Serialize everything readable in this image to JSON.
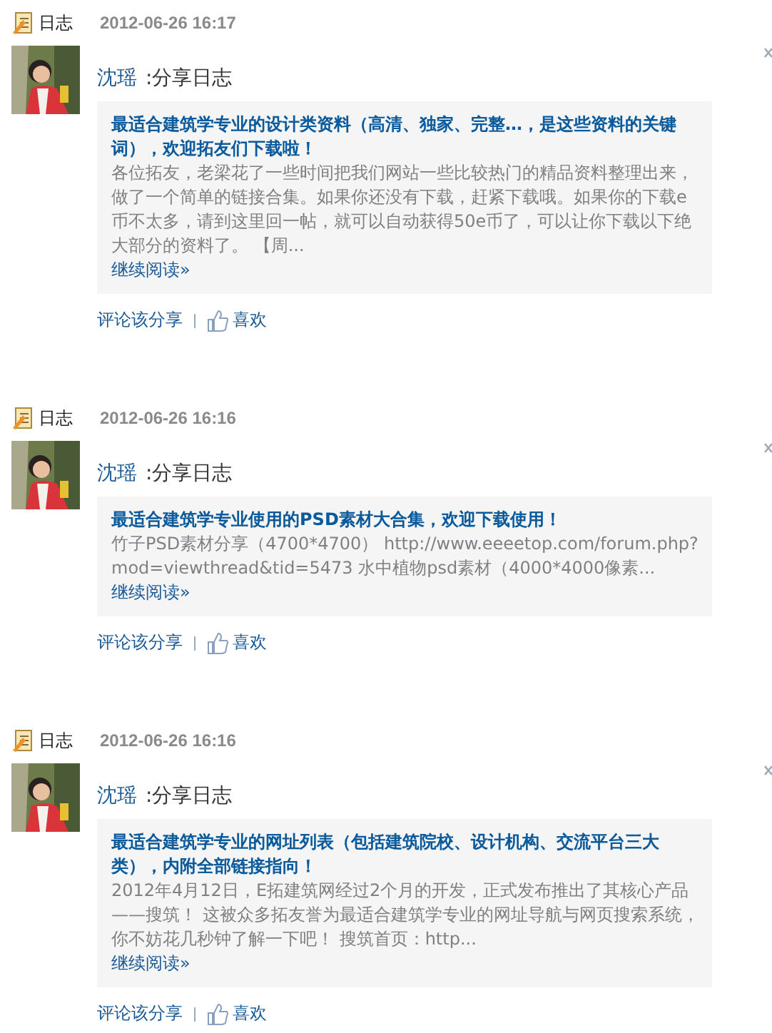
{
  "entries": [
    {
      "type_label": "日志",
      "time": "2012-06-26 16:17",
      "author": "沈瑶",
      "action": ":分享日志",
      "title": "最适合建筑学专业的设计类资料（高清、独家、完整…，是这些资料的关键词），欢迎拓友们下载啦！",
      "summary": "各位拓友，老梁花了一些时间把我们网站一些比较热门的精品资料整理出来，做了一个简单的链接合集。如果你还没有下载，赶紧下载哦。如果你的下载e币不太多，请到这里回一帖，就可以自动获得50e币了，可以让你下载以下绝大部分的资料了。 【周...",
      "more": "继续阅读»",
      "comment": "评论该分享",
      "like": "喜欢"
    },
    {
      "type_label": "日志",
      "time": "2012-06-26 16:16",
      "author": "沈瑶",
      "action": ":分享日志",
      "title": "最适合建筑学专业使用的PSD素材大合集，欢迎下载使用！",
      "summary": "竹子PSD素材分享（4700*4700） http://www.eeeetop.com/forum.php?mod=viewthread&tid=5473 水中植物psd素材（4000*4000像素...",
      "more": "继续阅读»",
      "comment": "评论该分享",
      "like": "喜欢"
    },
    {
      "type_label": "日志",
      "time": "2012-06-26 16:16",
      "author": "沈瑶",
      "action": ":分享日志",
      "title": "最适合建筑学专业的网址列表（包括建筑院校、设计机构、交流平台三大类），内附全部链接指向！",
      "summary": "2012年4月12日，E拓建筑网经过2个月的开发，正式发布推出了其核心产品——搜筑！ 这被众多拓友誉为最适合建筑学专业的网址导航与网页搜索系统，你不妨花几秒钟了解一下吧！ 搜筑首页：http...",
      "more": "继续阅读»",
      "comment": "评论该分享",
      "like": "喜欢"
    }
  ]
}
